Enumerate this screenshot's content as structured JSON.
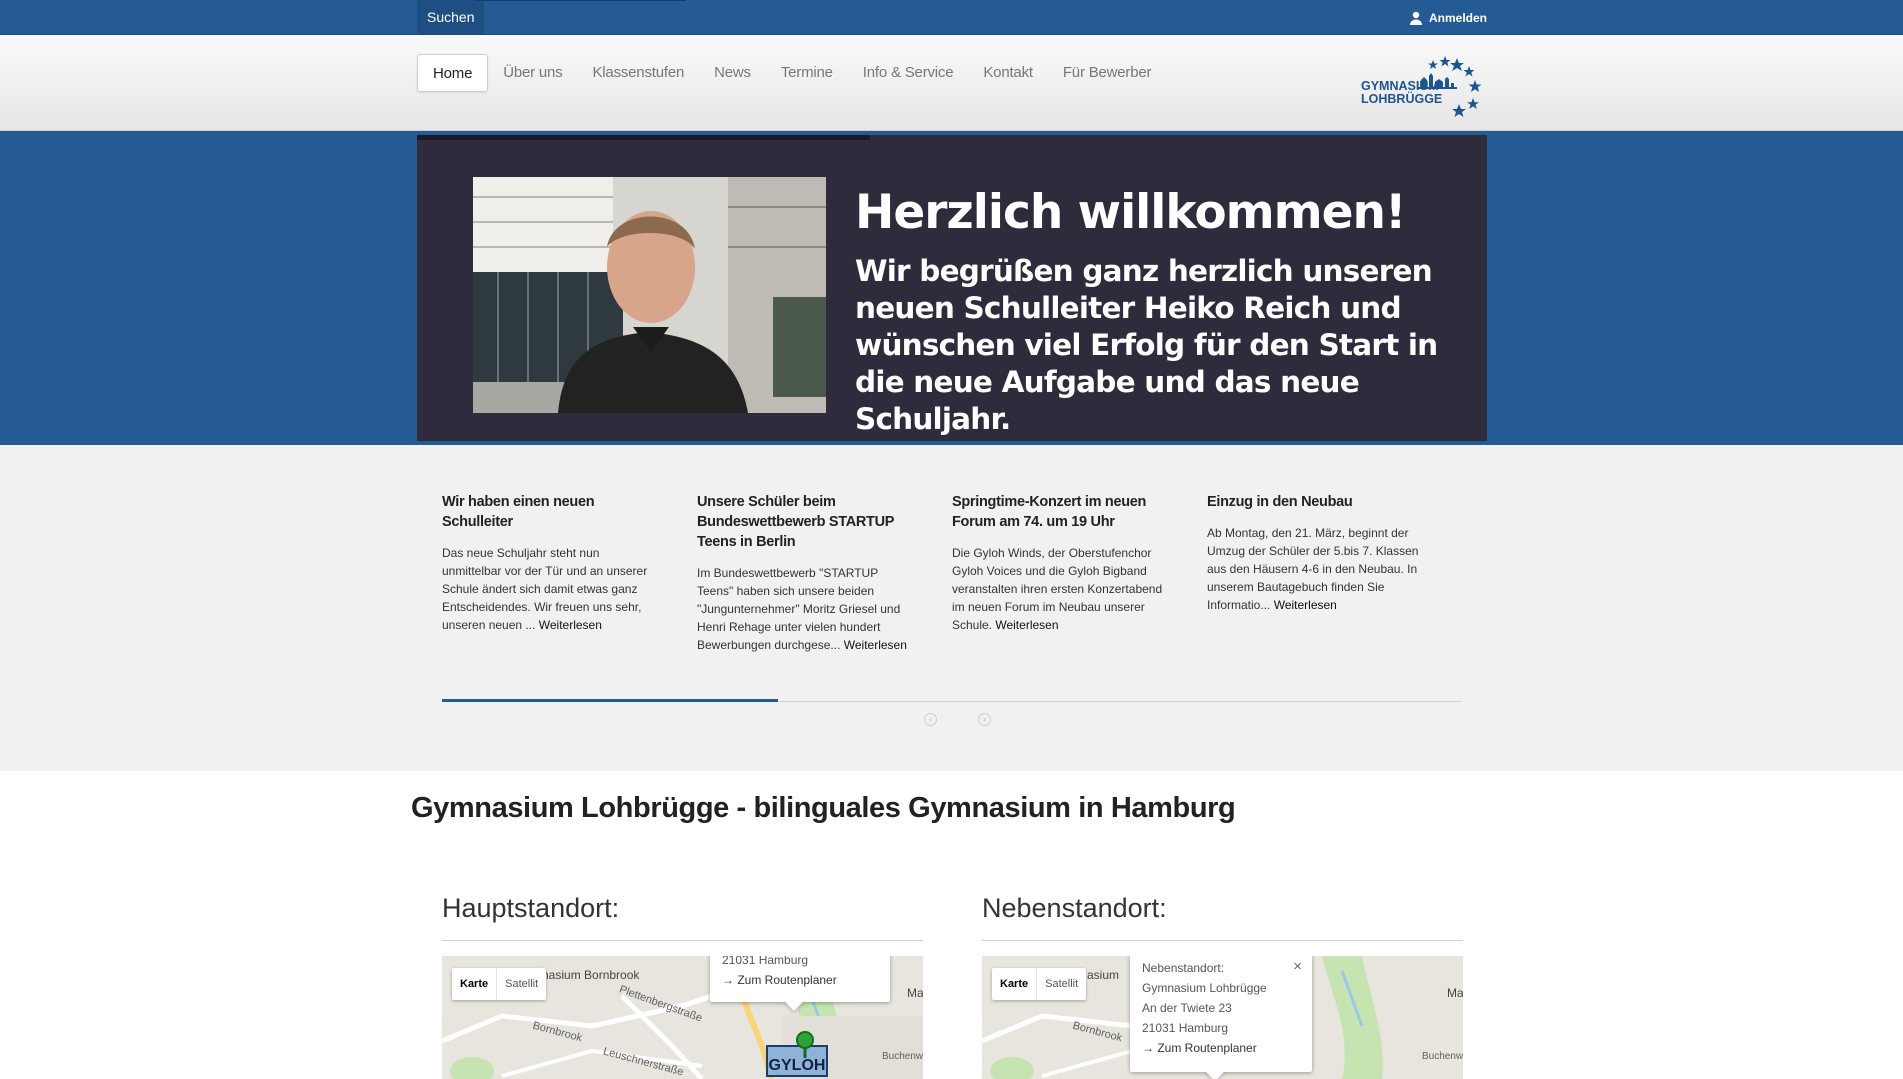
{
  "topbar": {
    "search_label": "Suchen",
    "login_label": "Anmelden"
  },
  "nav": {
    "items": [
      "Home",
      "Über uns",
      "Klassenstufen",
      "News",
      "Termine",
      "Info & Service",
      "Kontakt",
      "Für Bewerber"
    ],
    "active": "Home"
  },
  "logo": {
    "line1": "GYMNASIUM",
    "line2": "LOHBRÜGGE"
  },
  "slide": {
    "title": "Herzlich willkommen!",
    "text": "Wir begrüßen ganz herzlich unseren neuen Schulleiter Heiko Reich und wünschen viel Erfolg für den Start in die neue Aufgabe und das neue Schuljahr."
  },
  "news": [
    {
      "title": "Wir haben einen neuen Schulleiter",
      "text": "Das neue Schuljahr steht nun unmittelbar vor der Tür und an unserer Schule ändert sich damit etwas ganz Entscheidendes. Wir freuen uns sehr, unseren neuen ... ",
      "more": "Weiterlesen"
    },
    {
      "title": "Unsere Schüler beim Bundeswettbewerb STARTUP Teens in Berlin",
      "text": "Im Bundeswettbewerb \"STARTUP Teens\" haben sich unsere beiden \"Jungunternehmer\" Moritz Griesel und Henri Rehage unter vielen hundert Bewerbungen durchgese... ",
      "more": "Weiterlesen"
    },
    {
      "title": "Springtime-Konzert im neuen Forum am 74. um 19 Uhr",
      "text": "Die Gyloh Winds, der Oberstufenchor Gyloh Voices und die Gyloh Bigband veranstalten ihren ersten Konzertabend im neuen Forum im Neubau unserer Schule. ",
      "more": "Weiterlesen"
    },
    {
      "title": "Einzug in den Neubau",
      "text": "Ab Montag, den 21. März, beginnt der Umzug der Schüler der 5.bis 7. Klassen aus den Häusern 4-6 in den Neubau. In unserem Bautagebuch finden Sie Informatio... ",
      "more": "Weiterlesen"
    }
  ],
  "main": {
    "title": "Gymnasium Lohbrügge - bilinguales Gymnasium in Hamburg"
  },
  "locations": {
    "main": {
      "title": "Hauptstandort:",
      "bubble_line": "21031 Hamburg",
      "route": "→ Zum Routenplaner",
      "marker": "GYLOH",
      "labels": [
        "nasium Bornbrook",
        "Plettenbergstraße",
        "Bornbrook",
        "Leuschnerstraße",
        "Buchenw"
      ]
    },
    "secondary": {
      "title": "Nebenstandort:",
      "bubble_lines": [
        "Nebenstandort:",
        "Gymnasium Lohbrügge",
        "An der Twiete 23",
        "21031 Hamburg"
      ],
      "route": "→ Zum Routenplaner",
      "close": "×",
      "labels": [
        "asium",
        "Bornbrook",
        "Ma",
        "Buchenw"
      ]
    },
    "main_map_labels_extra": [
      "Ma"
    ]
  },
  "map_controls": {
    "map": "Karte",
    "satellite": "Satellit"
  },
  "colors": {
    "brand_blue": "#245b94",
    "slide_bg": "#2d2b3c"
  }
}
